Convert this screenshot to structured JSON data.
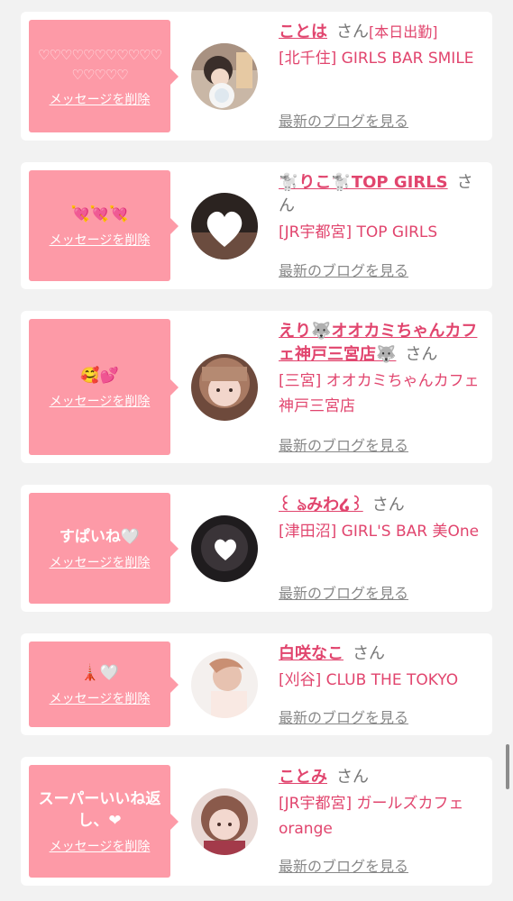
{
  "delete_label": "メッセージを削除",
  "blog_label": "最新のブログを見る",
  "honorific": "さん",
  "colors": {
    "accent": "#e1456e",
    "bubble": "#fd9aa7",
    "background": "#f2f2f2"
  },
  "cards": [
    {
      "message": "♡♡♡♡♡♡♡♡♡♡♡♡♡♡♡♡",
      "name": "ことは",
      "tag": "[本日出勤]",
      "shop": "[北千住] GIRLS BAR SMILE",
      "avatar": "avatar-1"
    },
    {
      "message": "💘💘💘",
      "name": "🐩りこ🐩TOP GIRLS",
      "tag": "",
      "shop": "[JR宇都宮] TOP GIRLS",
      "avatar": "avatar-2"
    },
    {
      "message": "🥰💕",
      "name": "えり🐺オオカミちゃんカフェ神戸三宮店🐺",
      "tag": "",
      "shop": "[三宮] オオカミちゃんカフェ神戸三宮店",
      "avatar": "avatar-3"
    },
    {
      "message": "すぱいね🤍",
      "name": "꒰ ঌみわ໒꒱",
      "tag": "",
      "shop": "[津田沼] GIRL'S BAR 美One",
      "avatar": "avatar-4"
    },
    {
      "message": "🗼🤍",
      "name": "白咲なこ",
      "tag": "",
      "shop": "[刈谷] CLUB THE TOKYO",
      "avatar": "avatar-5"
    },
    {
      "message": "スーパーいいね返し、❤︎",
      "name": "ことみ",
      "tag": "",
      "shop": "[JR宇都宮] ガールズカフェ orange",
      "avatar": "avatar-6"
    }
  ]
}
